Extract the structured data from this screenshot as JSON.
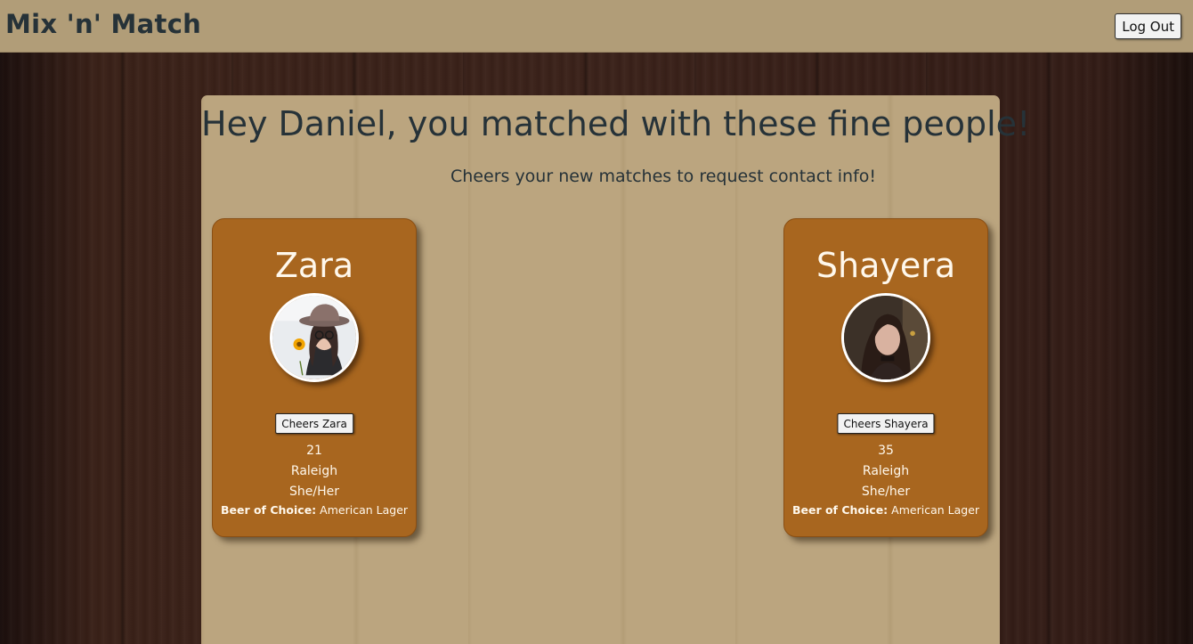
{
  "navbar": {
    "brand": "Mix 'n' Match",
    "logout_label": "Log Out"
  },
  "main": {
    "heading": "Hey Daniel, you matched with these fine people!",
    "subheading": "Cheers your new matches to request contact info!"
  },
  "matches": [
    {
      "name": "Zara",
      "button_label": "Cheers Zara",
      "age": "21",
      "city": "Raleigh",
      "pronouns": "She/Her",
      "beer_label": "Beer of Choice:",
      "beer": "American Lager"
    },
    {
      "name": "Shayera",
      "button_label": "Cheers Shayera",
      "age": "35",
      "city": "Raleigh",
      "pronouns": "She/her",
      "beer_label": "Beer of Choice:",
      "beer": "American Lager"
    }
  ],
  "colors": {
    "navbar": "#b19d78",
    "panel": "#bba57f",
    "card": "#a8661f",
    "text": "#263238"
  }
}
